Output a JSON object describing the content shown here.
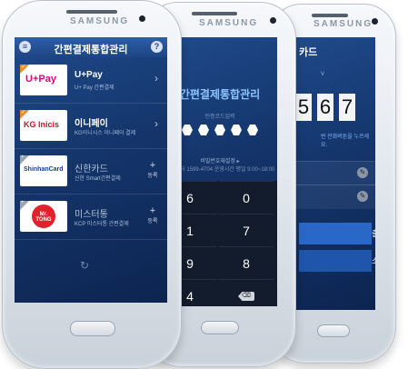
{
  "brand": "SAMSUNG",
  "phone1": {
    "title": "간편결제통합관리",
    "menu_icon": "menu-icon",
    "help_label": "?",
    "items": [
      {
        "logo": "U+Pay",
        "name": "U+Pay",
        "sub": "U+ Pay 간편결제",
        "registered": true,
        "action": "›",
        "corner": "✓"
      },
      {
        "logo": "KG Inicis",
        "name": "이니페이",
        "sub": "KG이니시스 이니페이 결제",
        "registered": true,
        "action": "›",
        "corner": "✓"
      },
      {
        "logo": "ShinhanCard",
        "name": "신한카드",
        "sub": "신한 Smart간편결제",
        "registered": false,
        "action": "+",
        "action_label": "등록",
        "corner": "+"
      },
      {
        "logo": "Mr. TONG",
        "name": "미스터통",
        "sub": "KCP 미스터통 간편결제",
        "registered": false,
        "action": "+",
        "action_label": "등록",
        "corner": "+"
      }
    ],
    "refresh_icon": "refresh-icon"
  },
  "phone2": {
    "title": "간편결제통합관리",
    "pin_label": "인증코드입력",
    "dots_count": 5,
    "link": "비밀번호재설정 ▸",
    "info": "고객센터 1599-4704 운영시간 평일 9:00~18:00",
    "keys": [
      "6",
      "0",
      "1",
      "7",
      "9",
      "8",
      "4",
      "⌫"
    ]
  },
  "phone3": {
    "title": "카드",
    "small": "V",
    "digits": [
      "5",
      "6",
      "7"
    ],
    "note": "번 전화버튼을 누르세요.",
    "rows": [
      "",
      "",
      ""
    ],
    "button1": "출",
    "button2": "소"
  },
  "colors": {
    "screen_top": "#1f4a8a",
    "screen_bottom": "#0d2450",
    "accent_orange": "#f08c1a",
    "button_blue": "#2a68c8"
  }
}
